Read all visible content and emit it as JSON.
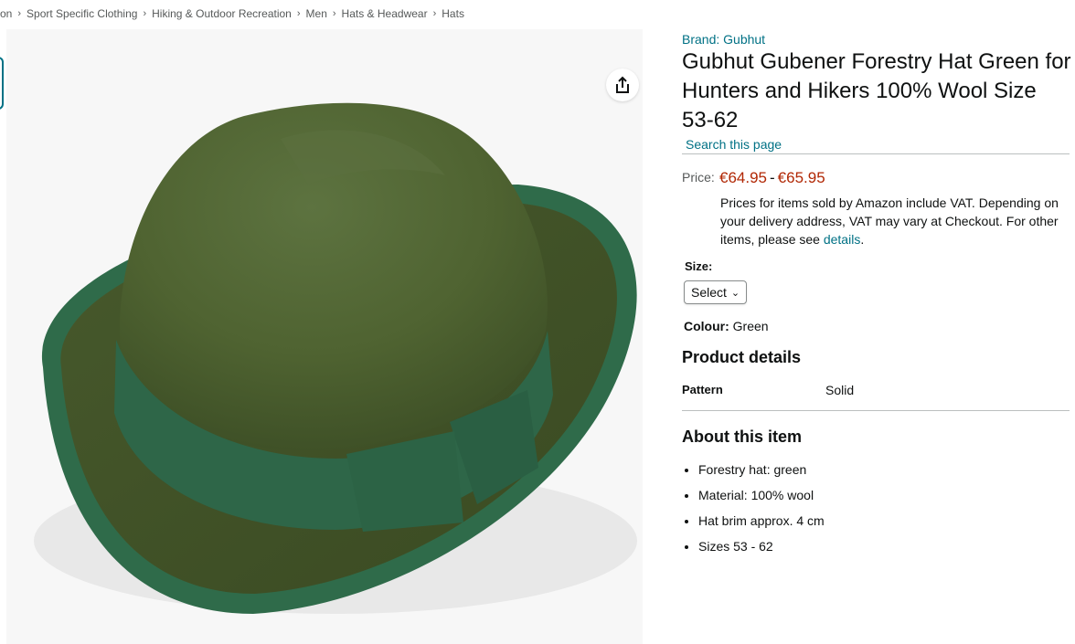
{
  "breadcrumb": {
    "items": [
      "on",
      "Sport Specific Clothing",
      "Hiking & Outdoor Recreation",
      "Men",
      "Hats & Headwear",
      "Hats"
    ],
    "separator": "›"
  },
  "product": {
    "brand": "Brand: Gubhut",
    "title": "Gubhut Gubener Forestry Hat Green for Hunters and Hikers 100% Wool Size 53-62",
    "search_link": "Search this page",
    "price_label": "Price:",
    "price_low": "€64.95",
    "price_dash": "-",
    "price_high": "€65.95",
    "vat_note": "Prices for items sold by Amazon include VAT. Depending on your delivery address, VAT may vary at Checkout. For other items, please see ",
    "vat_link": "details",
    "vat_end": ".",
    "size_label": "Size:",
    "size_select_value": "Select",
    "colour_label": "Colour:",
    "colour_value": "Green"
  },
  "details": {
    "heading": "Product details",
    "pattern_label": "Pattern",
    "pattern_value": "Solid"
  },
  "about": {
    "heading": "About this item",
    "bullets": [
      "Forestry hat: green",
      "Material: 100% wool",
      "Hat brim approx. 4 cm",
      "Sizes 53 - 62"
    ]
  },
  "icons": {
    "share": "share-icon",
    "chevron": "chevron-down-icon"
  },
  "colors": {
    "link": "#007185",
    "price": "#b12704",
    "hat_crown": "#4f6331",
    "hat_band": "#2f6b4a"
  }
}
